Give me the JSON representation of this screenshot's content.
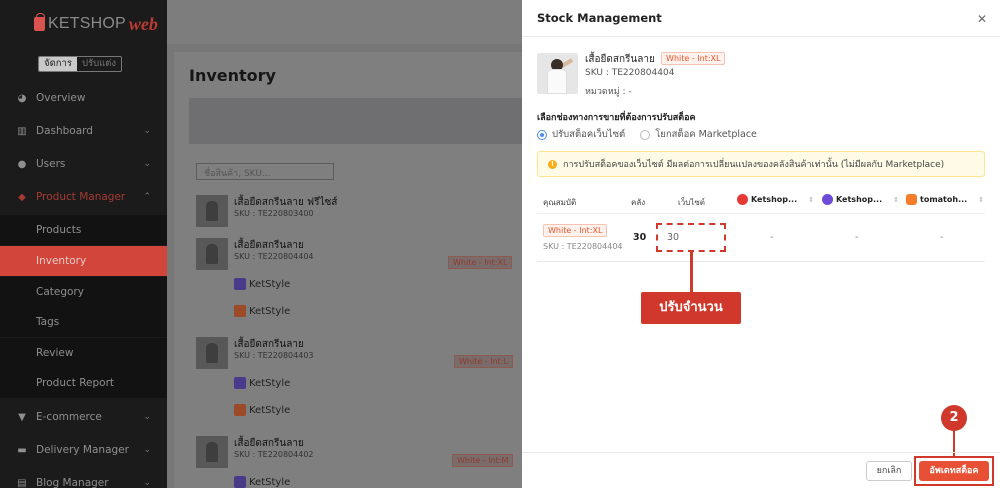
{
  "brand": {
    "name": "KETSHOP",
    "suffix": "web"
  },
  "mode_switch": {
    "options": [
      "จัดการ",
      "ปรับแต่ง"
    ],
    "selected": "จัดการ"
  },
  "sidebar": {
    "items": [
      {
        "label": "Overview",
        "icon": "pie-chart-icon"
      },
      {
        "label": "Dashboard",
        "icon": "bar-chart-icon"
      },
      {
        "label": "Users",
        "icon": "users-icon"
      },
      {
        "label": "Product Manager",
        "icon": "tag-icon"
      },
      {
        "label": "Products"
      },
      {
        "label": "Inventory"
      },
      {
        "label": "Category"
      },
      {
        "label": "Tags"
      },
      {
        "label": "Review"
      },
      {
        "label": "Product Report"
      },
      {
        "label": "E-commerce",
        "icon": "cart-icon"
      },
      {
        "label": "Delivery Manager",
        "icon": "truck-icon"
      },
      {
        "label": "Blog Manager",
        "icon": "blog-icon"
      }
    ],
    "active": "Inventory"
  },
  "inventory": {
    "title": "Inventory",
    "search_placeholder": "ชื่อสินค้า, SKU...",
    "products": [
      {
        "name": "เสื้อยืดสกรีนลาย ฟรีไซส์",
        "sku": "SKU : TE220803400"
      },
      {
        "name": "เสื้อยืดสกรีนลาย",
        "sku": "SKU : TE220804404",
        "variant": "White - Int:XL",
        "stores": [
          "KetStyle",
          "KetStyle"
        ]
      },
      {
        "name": "เสื้อยืดสกรีนลาย",
        "sku": "SKU : TE220804403",
        "variant": "White - Int:L",
        "stores": [
          "KetStyle",
          "KetStyle"
        ]
      },
      {
        "name": "เสื้อยืดสกรีนลาย",
        "sku": "SKU : TE220804402",
        "variant": "White - Int:M",
        "stores": [
          "KetStyle"
        ]
      }
    ]
  },
  "modal": {
    "title": "Stock Management",
    "product_name": "เสื้อยืดสกรีนลาย",
    "variant": "White - Int:XL",
    "sku": "SKU : TE220804404",
    "category": "หมวดหมู่ : -",
    "channel_label": "เลือกช่องทางการขายที่ต้องการปรับสต็อค",
    "channel_options": [
      "ปรับสต็อคเว็บไซต์",
      "โยกสต็อค Marketplace"
    ],
    "channel_selected": "ปรับสต็อคเว็บไซต์",
    "alert": "การปรับสต็อคของเว็บไซต์ มีผลต่อการเปลี่ยนแปลงของคลังสินค้าเท่านั้น (ไม่มีผลกับ Marketplace)",
    "table": {
      "headers": [
        "คุณสมบัติ",
        "คลัง",
        "เว็บไซต์"
      ],
      "stores": [
        "Ketshop...",
        "Ketshop...",
        "tomatoh..."
      ],
      "row": {
        "variant": "White - Int:XL",
        "sku": "SKU : TE220804404",
        "stock": "30",
        "web_value": "30",
        "store_values": [
          "-",
          "-",
          "-"
        ]
      }
    },
    "cancel_label": "ยกเลิก",
    "update_label": "อัพเดทสต็อค"
  },
  "annotations": {
    "callout_text": "ปรับจำนวน",
    "step_number": "2"
  },
  "colors": {
    "accent": "#d1382c",
    "primary_button": "#e85035",
    "link_blue": "#4a8fe7"
  }
}
